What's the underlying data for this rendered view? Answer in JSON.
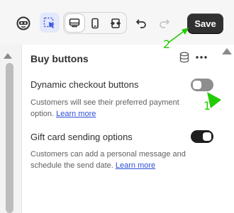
{
  "toolbar": {
    "save_label": "Save",
    "icons": [
      "robot-avatar-icon",
      "select-cursor-icon",
      "desktop-icon",
      "mobile-icon",
      "fullwidth-icon",
      "undo-icon",
      "redo-icon"
    ],
    "active_view": "desktop",
    "accent": "#303030"
  },
  "panel": {
    "title": "Buy buttons",
    "settings": [
      {
        "label": "Dynamic checkout buttons",
        "help": "Customers will see their preferred payment option.",
        "link": "Learn more",
        "enabled": false
      },
      {
        "label": "Gift card sending options",
        "help": "Customers can add a personal message and schedule the send date.",
        "link": "Learn more",
        "enabled": true
      }
    ]
  },
  "annotations": {
    "marker_1": "1",
    "marker_2": "2",
    "color": "#22cc00"
  }
}
